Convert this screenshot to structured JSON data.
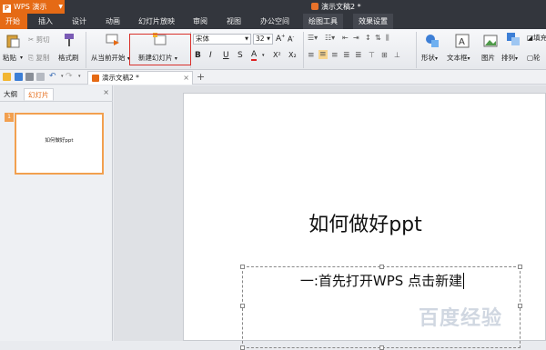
{
  "titlebar": {
    "app_name": "WPS 演示",
    "app_letter": "P",
    "doc_title": "演示文稿2 *"
  },
  "ribbon_tabs": {
    "items": [
      "开始",
      "插入",
      "设计",
      "动画",
      "幻灯片放映",
      "审阅",
      "视图",
      "办公空间",
      "绘图工具",
      "效果设置"
    ],
    "active": "开始"
  },
  "ribbon": {
    "paste_label": "粘贴",
    "cut_label": "剪切",
    "copy_label": "复制",
    "format_painter_label": "格式刷",
    "from_current_label": "从当前开始",
    "new_slide_label": "新建幻灯片",
    "font_name": "宋体",
    "font_size": "32",
    "bold": "B",
    "italic": "I",
    "underline": "U",
    "shadow": "S",
    "font_color": "A",
    "superscript": "X²",
    "subscript": "X₂",
    "shape_label": "形状",
    "textbox_label": "文本框",
    "picture_label": "图片",
    "arrange_label": "排列",
    "outline_label": "轮",
    "fill_label": "填充"
  },
  "document_tab": {
    "label": "演示文稿2 *"
  },
  "side_panel": {
    "tab_outline": "大纲",
    "tab_slides": "幻灯片",
    "active": "幻灯片",
    "slide_number": "1",
    "thumb_text": "如何做好ppt"
  },
  "slide": {
    "title": "如何做好ppt",
    "body": "一:首先打开WPS  点击新建"
  },
  "watermark": "百度经验",
  "colors": {
    "accent": "#e56a15",
    "titlebar": "#33363d",
    "highlight_box": "#d9312c"
  }
}
